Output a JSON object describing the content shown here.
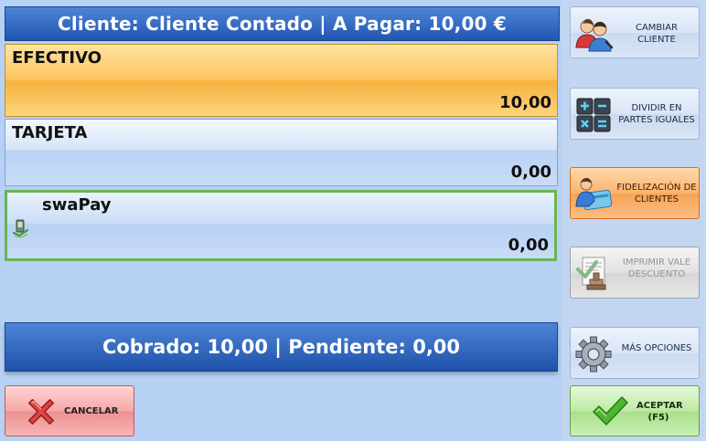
{
  "header": {
    "text": "Cliente: Cliente Contado  | A Pagar: 10,00 €"
  },
  "payments": [
    {
      "name": "EFECTIVO",
      "amount": "10,00"
    },
    {
      "name": "TARJETA",
      "amount": "0,00"
    },
    {
      "name": "swaPay",
      "amount": "0,00"
    }
  ],
  "totals": {
    "text": "Cobrado: 10,00 | Pendiente: 0,00"
  },
  "buttons": {
    "cancelar": "CANCELAR",
    "cambiar_cliente": "CAMBIAR CLIENTE",
    "dividir": "DIVIDIR EN PARTES IGUALES",
    "fidelizacion": "FIDELIZACIÓN DE CLIENTES",
    "imprimir_vale": "IMPRIMIR VALE DESCUENTO",
    "mas_opciones": "MÁS OPCIONES",
    "aceptar": "ACEPTAR (F5)"
  },
  "icons": {
    "cambiar_cliente": "users-icon",
    "dividir": "calculator-icon",
    "fidelizacion": "loyalty-card-icon",
    "imprimir_vale": "stamp-icon",
    "mas_opciones": "gear-icon",
    "cancelar": "x-icon",
    "aceptar": "checkmark-icon",
    "swapay": "swapay-icon"
  },
  "colors": {
    "header_blue": "#2d63bd",
    "efectivo_orange": "#f7b13f",
    "swapay_border": "#6ab552",
    "cancel_red": "#ee9090",
    "accept_green": "#a8e08a",
    "fidelizacion_orange": "#f7a257"
  },
  "selected_payment": "swaPay"
}
